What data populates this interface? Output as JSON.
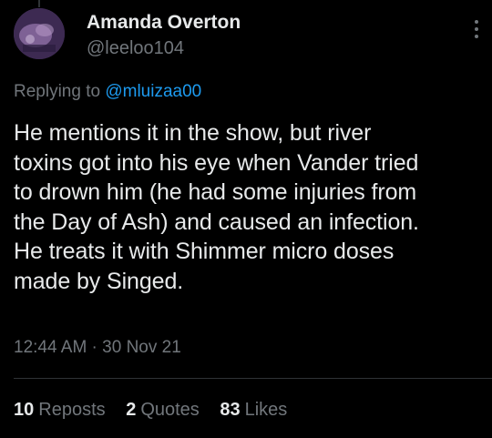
{
  "author": {
    "display_name": "Amanda Overton",
    "handle": "@leeloo104",
    "avatar_icon": "profile-avatar"
  },
  "menu_icon": "more-vertical-icon",
  "reply_context": {
    "prefix": "Replying to",
    "mention": "@mluizaa00"
  },
  "tweet": {
    "text_lines": [
      "He mentions it in the show, but river",
      "toxins got into his eye when Vander tried",
      "to drown him (he had some injuries from",
      "the Day of Ash) and caused an infection.",
      "He treats it with Shimmer micro doses",
      "made by Singed."
    ]
  },
  "timestamp": "12:44 AM · 30 Nov 21",
  "stats": {
    "reposts": {
      "count": "10",
      "label": "Reposts"
    },
    "quotes": {
      "count": "2",
      "label": "Quotes"
    },
    "likes": {
      "count": "83",
      "label": "Likes"
    }
  },
  "colors": {
    "background": "#000000",
    "primary_text": "#e7e9ea",
    "secondary_text": "#71767b",
    "accent": "#1d9bf0",
    "divider": "#2f3336"
  }
}
